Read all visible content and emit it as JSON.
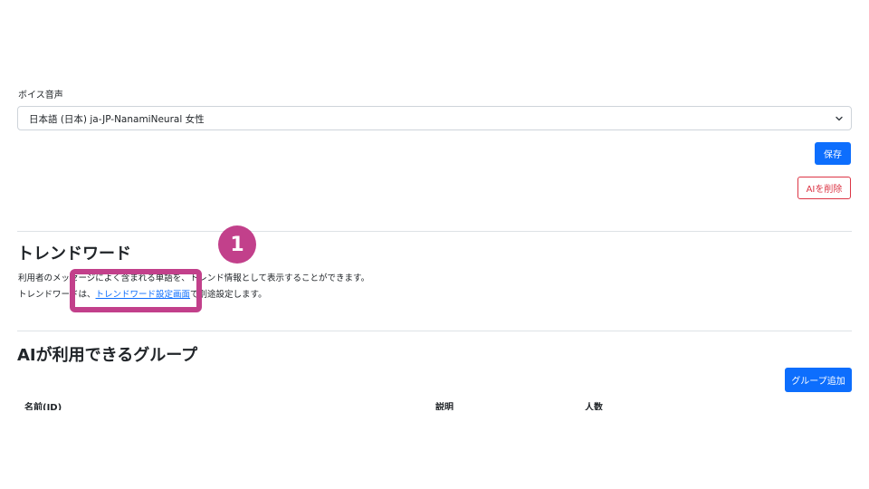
{
  "voice": {
    "label": "ボイス音声",
    "selected_value": "日本語 (日本) ja-JP-NanamiNeural 女性"
  },
  "buttons": {
    "save": "保存",
    "delete_ai": "AIを削除",
    "add_group": "グループ追加"
  },
  "trend": {
    "title": "トレンドワード",
    "desc_line1": "利用者のメッセージによく含まれる単語を、トレンド情報として表示することができます。",
    "desc_line2_prefix": "トレンドワードは、",
    "desc_line2_link": "トレンドワード設定画面",
    "desc_line2_suffix": "で別途設定します。"
  },
  "ai_groups": {
    "title": "AIが利用できるグループ",
    "columns": [
      "名前(ID)",
      "説明",
      "人数"
    ]
  },
  "annotation": {
    "step_number": "1",
    "color": "#c2408b"
  },
  "colors": {
    "primary": "#0d6efd",
    "danger": "#dc3545",
    "border": "#ced4da",
    "divider": "#dee2e6"
  }
}
